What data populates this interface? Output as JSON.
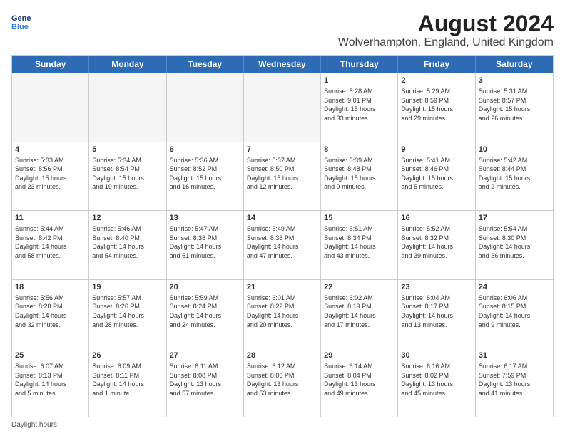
{
  "logo": {
    "line1": "General",
    "line2": "Blue"
  },
  "title": "August 2024",
  "location": "Wolverhampton, England, United Kingdom",
  "days_of_week": [
    "Sunday",
    "Monday",
    "Tuesday",
    "Wednesday",
    "Thursday",
    "Friday",
    "Saturday"
  ],
  "footer": "Daylight hours",
  "weeks": [
    [
      {
        "day": "",
        "info": ""
      },
      {
        "day": "",
        "info": ""
      },
      {
        "day": "",
        "info": ""
      },
      {
        "day": "",
        "info": ""
      },
      {
        "day": "1",
        "info": "Sunrise: 5:28 AM\nSunset: 9:01 PM\nDaylight: 15 hours\nand 33 minutes."
      },
      {
        "day": "2",
        "info": "Sunrise: 5:29 AM\nSunset: 8:59 PM\nDaylight: 15 hours\nand 29 minutes."
      },
      {
        "day": "3",
        "info": "Sunrise: 5:31 AM\nSunset: 8:57 PM\nDaylight: 15 hours\nand 26 minutes."
      }
    ],
    [
      {
        "day": "4",
        "info": "Sunrise: 5:33 AM\nSunset: 8:56 PM\nDaylight: 15 hours\nand 23 minutes."
      },
      {
        "day": "5",
        "info": "Sunrise: 5:34 AM\nSunset: 8:54 PM\nDaylight: 15 hours\nand 19 minutes."
      },
      {
        "day": "6",
        "info": "Sunrise: 5:36 AM\nSunset: 8:52 PM\nDaylight: 15 hours\nand 16 minutes."
      },
      {
        "day": "7",
        "info": "Sunrise: 5:37 AM\nSunset: 8:50 PM\nDaylight: 15 hours\nand 12 minutes."
      },
      {
        "day": "8",
        "info": "Sunrise: 5:39 AM\nSunset: 8:48 PM\nDaylight: 15 hours\nand 9 minutes."
      },
      {
        "day": "9",
        "info": "Sunrise: 5:41 AM\nSunset: 8:46 PM\nDaylight: 15 hours\nand 5 minutes."
      },
      {
        "day": "10",
        "info": "Sunrise: 5:42 AM\nSunset: 8:44 PM\nDaylight: 15 hours\nand 2 minutes."
      }
    ],
    [
      {
        "day": "11",
        "info": "Sunrise: 5:44 AM\nSunset: 8:42 PM\nDaylight: 14 hours\nand 58 minutes."
      },
      {
        "day": "12",
        "info": "Sunrise: 5:46 AM\nSunset: 8:40 PM\nDaylight: 14 hours\nand 54 minutes."
      },
      {
        "day": "13",
        "info": "Sunrise: 5:47 AM\nSunset: 8:38 PM\nDaylight: 14 hours\nand 51 minutes."
      },
      {
        "day": "14",
        "info": "Sunrise: 5:49 AM\nSunset: 8:36 PM\nDaylight: 14 hours\nand 47 minutes."
      },
      {
        "day": "15",
        "info": "Sunrise: 5:51 AM\nSunset: 8:34 PM\nDaylight: 14 hours\nand 43 minutes."
      },
      {
        "day": "16",
        "info": "Sunrise: 5:52 AM\nSunset: 8:32 PM\nDaylight: 14 hours\nand 39 minutes."
      },
      {
        "day": "17",
        "info": "Sunrise: 5:54 AM\nSunset: 8:30 PM\nDaylight: 14 hours\nand 36 minutes."
      }
    ],
    [
      {
        "day": "18",
        "info": "Sunrise: 5:56 AM\nSunset: 8:28 PM\nDaylight: 14 hours\nand 32 minutes."
      },
      {
        "day": "19",
        "info": "Sunrise: 5:57 AM\nSunset: 8:26 PM\nDaylight: 14 hours\nand 28 minutes."
      },
      {
        "day": "20",
        "info": "Sunrise: 5:59 AM\nSunset: 8:24 PM\nDaylight: 14 hours\nand 24 minutes."
      },
      {
        "day": "21",
        "info": "Sunrise: 6:01 AM\nSunset: 8:22 PM\nDaylight: 14 hours\nand 20 minutes."
      },
      {
        "day": "22",
        "info": "Sunrise: 6:02 AM\nSunset: 8:19 PM\nDaylight: 14 hours\nand 17 minutes."
      },
      {
        "day": "23",
        "info": "Sunrise: 6:04 AM\nSunset: 8:17 PM\nDaylight: 14 hours\nand 13 minutes."
      },
      {
        "day": "24",
        "info": "Sunrise: 6:06 AM\nSunset: 8:15 PM\nDaylight: 14 hours\nand 9 minutes."
      }
    ],
    [
      {
        "day": "25",
        "info": "Sunrise: 6:07 AM\nSunset: 8:13 PM\nDaylight: 14 hours\nand 5 minutes."
      },
      {
        "day": "26",
        "info": "Sunrise: 6:09 AM\nSunset: 8:11 PM\nDaylight: 14 hours\nand 1 minute."
      },
      {
        "day": "27",
        "info": "Sunrise: 6:11 AM\nSunset: 8:08 PM\nDaylight: 13 hours\nand 57 minutes."
      },
      {
        "day": "28",
        "info": "Sunrise: 6:12 AM\nSunset: 8:06 PM\nDaylight: 13 hours\nand 53 minutes."
      },
      {
        "day": "29",
        "info": "Sunrise: 6:14 AM\nSunset: 8:04 PM\nDaylight: 13 hours\nand 49 minutes."
      },
      {
        "day": "30",
        "info": "Sunrise: 6:16 AM\nSunset: 8:02 PM\nDaylight: 13 hours\nand 45 minutes."
      },
      {
        "day": "31",
        "info": "Sunrise: 6:17 AM\nSunset: 7:59 PM\nDaylight: 13 hours\nand 41 minutes."
      }
    ]
  ]
}
